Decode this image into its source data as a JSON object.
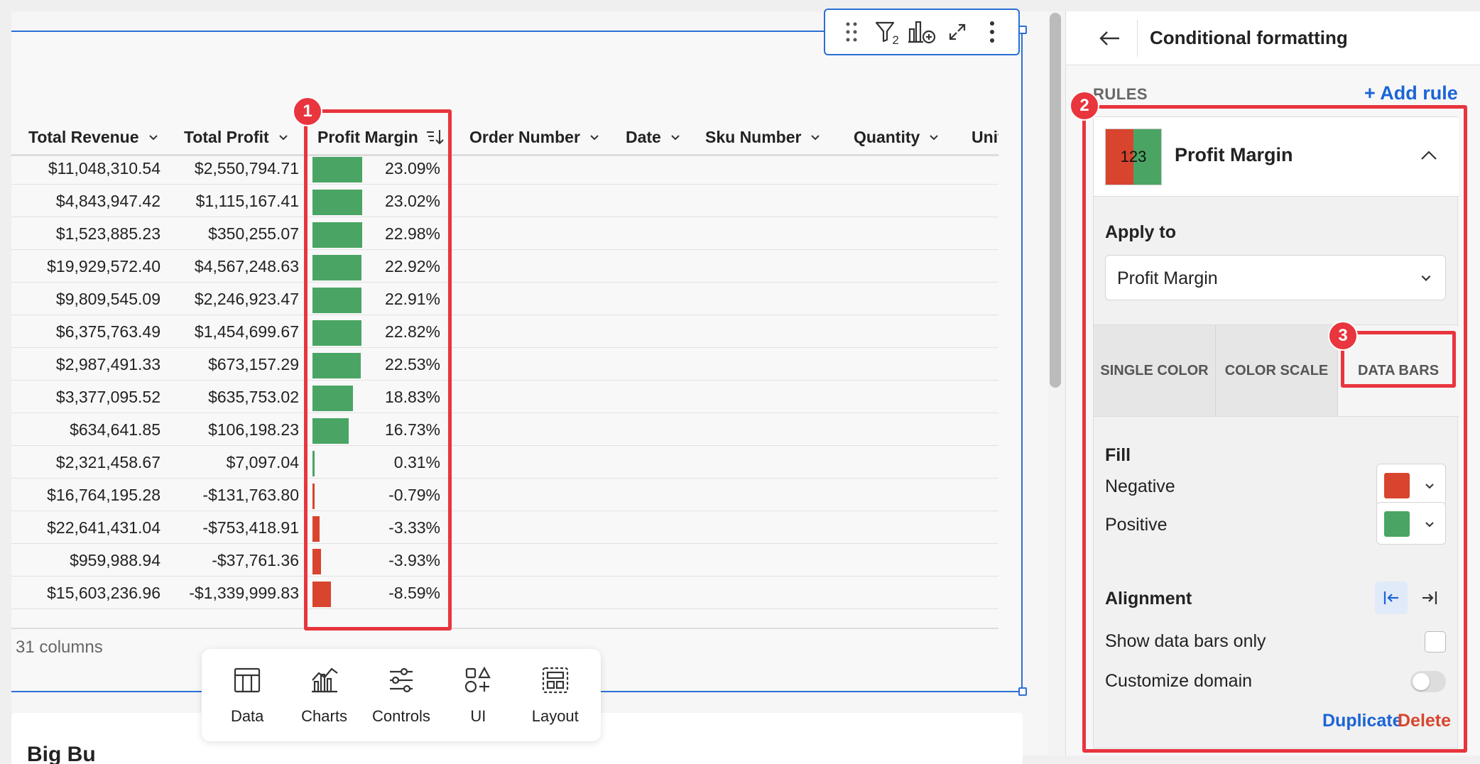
{
  "table": {
    "columns": [
      {
        "label": "Total Revenue"
      },
      {
        "label": "Total Profit"
      },
      {
        "label": "Profit Margin"
      },
      {
        "label": "Order Number"
      },
      {
        "label": "Date"
      },
      {
        "label": "Sku Number"
      },
      {
        "label": "Quantity"
      },
      {
        "label": "Unit"
      }
    ],
    "rows": [
      {
        "revenue": "$11,048,310.54",
        "profit": "$2,550,794.71",
        "margin": "23.09%",
        "margin_value": 23.09
      },
      {
        "revenue": "$4,843,947.42",
        "profit": "$1,115,167.41",
        "margin": "23.02%",
        "margin_value": 23.02
      },
      {
        "revenue": "$1,523,885.23",
        "profit": "$350,255.07",
        "margin": "22.98%",
        "margin_value": 22.98
      },
      {
        "revenue": "$19,929,572.40",
        "profit": "$4,567,248.63",
        "margin": "22.92%",
        "margin_value": 22.92
      },
      {
        "revenue": "$9,809,545.09",
        "profit": "$2,246,923.47",
        "margin": "22.91%",
        "margin_value": 22.91
      },
      {
        "revenue": "$6,375,763.49",
        "profit": "$1,454,699.67",
        "margin": "22.82%",
        "margin_value": 22.82
      },
      {
        "revenue": "$2,987,491.33",
        "profit": "$673,157.29",
        "margin": "22.53%",
        "margin_value": 22.53
      },
      {
        "revenue": "$3,377,095.52",
        "profit": "$635,753.02",
        "margin": "18.83%",
        "margin_value": 18.83
      },
      {
        "revenue": "$634,641.85",
        "profit": "$106,198.23",
        "margin": "16.73%",
        "margin_value": 16.73
      },
      {
        "revenue": "$2,321,458.67",
        "profit": "$7,097.04",
        "margin": "0.31%",
        "margin_value": 0.31
      },
      {
        "revenue": "$16,764,195.28",
        "profit": "-$131,763.80",
        "margin": "-0.79%",
        "margin_value": -0.79
      },
      {
        "revenue": "$22,641,431.04",
        "profit": "-$753,418.91",
        "margin": "-3.33%",
        "margin_value": -3.33
      },
      {
        "revenue": "$959,988.94",
        "profit": "-$37,761.36",
        "margin": "-3.93%",
        "margin_value": -3.93
      },
      {
        "revenue": "$15,603,236.96",
        "profit": "-$1,339,999.83",
        "margin": "-8.59%",
        "margin_value": -8.59
      }
    ],
    "column_count": "31 columns"
  },
  "toolbar": {
    "filter_badge": "2",
    "icons": [
      "drag-handle-icon",
      "filter-icon",
      "add-chart-icon",
      "expand-icon",
      "more-icon"
    ]
  },
  "dock": {
    "items": [
      {
        "label": "Data",
        "icon": "table-icon"
      },
      {
        "label": "Charts",
        "icon": "chart-icon"
      },
      {
        "label": "Controls",
        "icon": "sliders-icon"
      },
      {
        "label": "UI",
        "icon": "shapes-icon"
      },
      {
        "label": "Layout",
        "icon": "layout-icon"
      }
    ]
  },
  "bottom_card": {
    "title": "Big Bu"
  },
  "annotations": {
    "one": "1",
    "two": "2",
    "three": "3"
  },
  "panel": {
    "title": "Conditional formatting",
    "rules_label": "RULES",
    "add_rule": "+ Add rule",
    "rule": {
      "thumb_text": "123",
      "name": "Profit Margin",
      "apply_to_label": "Apply to",
      "apply_to_value": "Profit Margin",
      "tabs": [
        "SINGLE COLOR",
        "COLOR SCALE",
        "DATA BARS"
      ],
      "active_tab": "DATA BARS",
      "fill_label": "Fill",
      "negative_label": "Negative",
      "positive_label": "Positive",
      "alignment_label": "Alignment",
      "show_bars_only_label": "Show data bars only",
      "show_bars_only_checked": false,
      "customize_domain_label": "Customize domain",
      "customize_domain_on": false,
      "duplicate_label": "Duplicate",
      "delete_label": "Delete"
    }
  },
  "colors": {
    "negative": "#d9442e",
    "positive": "#4aa564",
    "accent": "#1b64d6",
    "annotation": "#e8353e"
  }
}
